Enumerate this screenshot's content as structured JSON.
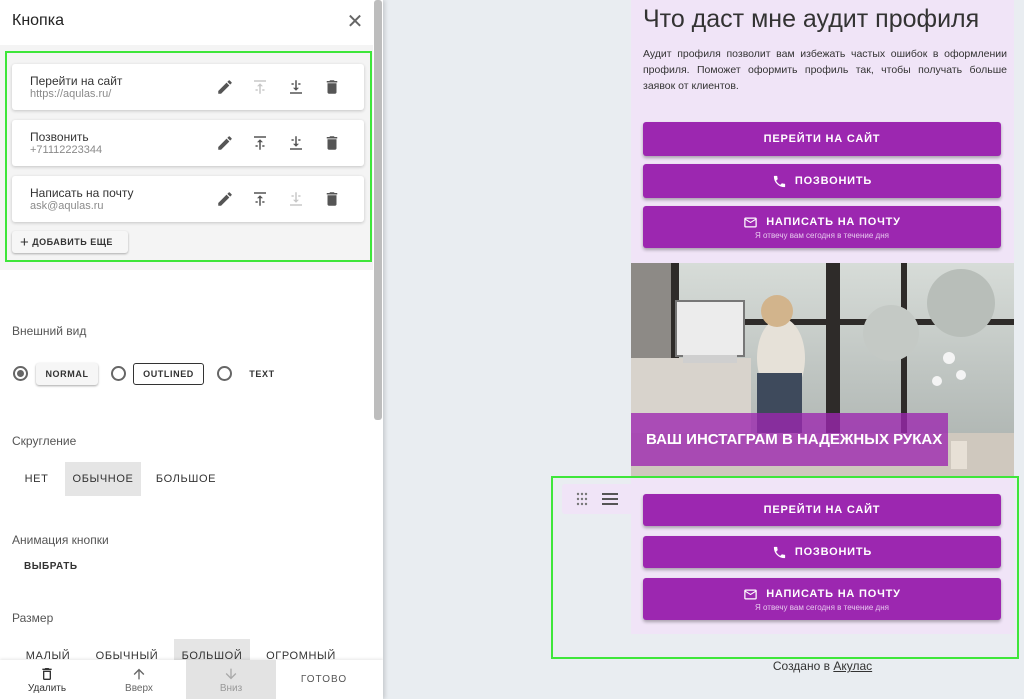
{
  "panel": {
    "title": "Кнопка",
    "buttons": [
      {
        "title": "Перейти на сайт",
        "subtitle": "https://aqulas.ru/"
      },
      {
        "title": "Позвонить",
        "subtitle": "+71112223344"
      },
      {
        "title": "Написать на почту",
        "subtitle": "ask@aqulas.ru"
      }
    ],
    "add_more": "ДОБАВИТЬ ЕЩЕ",
    "appearance": {
      "label": "Внешний вид",
      "options": [
        "NORMAL",
        "OUTLINED",
        "TEXT"
      ],
      "selected": "NORMAL"
    },
    "rounding": {
      "label": "Скругление",
      "options": [
        "НЕТ",
        "ОБЫЧНОЕ",
        "БОЛЬШОЕ"
      ],
      "selected": "ОБЫЧНОЕ"
    },
    "animation": {
      "label": "Анимация кнопки",
      "choose": "ВЫБРАТЬ"
    },
    "size": {
      "label": "Размер",
      "options": [
        "МАЛЫЙ",
        "ОБЫЧНЫЙ",
        "БОЛЬШОЙ",
        "ОГРОМНЫЙ"
      ],
      "selected": "БОЛЬШОЙ"
    },
    "bottom_bar": {
      "delete": "Удалить",
      "up": "Вверх",
      "down": "Вниз",
      "done": "ГОТОВО"
    }
  },
  "preview": {
    "heading": "Что даст мне аудит профиля",
    "text": "Аудит профиля позволит вам избежать частых ошибок в оформлении профиля. Поможет оформить профиль так, чтобы получать больше заявок от клиентов.",
    "buttons_top": [
      {
        "label": "ПЕРЕЙТИ НА САЙТ",
        "icon": ""
      },
      {
        "label": "ПОЗВОНИТЬ",
        "icon": "phone-icon"
      },
      {
        "label": "НАПИСАТЬ НА ПОЧТУ",
        "icon": "mail-icon",
        "sub": "Я отвечу вам сегодня в течение дня"
      }
    ],
    "photo_caption": "ВАШ ИНСТАГРАМ В НАДЕЖНЫХ РУКАХ",
    "buttons_bottom": [
      {
        "label": "ПЕРЕЙТИ НА САЙТ",
        "icon": ""
      },
      {
        "label": "ПОЗВОНИТЬ",
        "icon": "phone-icon"
      },
      {
        "label": "НАПИСАТЬ НА ПОЧТУ",
        "icon": "mail-icon",
        "sub": "Я отвечу вам сегодня в течение дня"
      }
    ],
    "footer_prefix": "Создано в ",
    "footer_link": "Акулас"
  },
  "colors": {
    "accent": "#9c27b0",
    "preview_bg": "#f0e4f7",
    "selection": "#3ee63a"
  }
}
